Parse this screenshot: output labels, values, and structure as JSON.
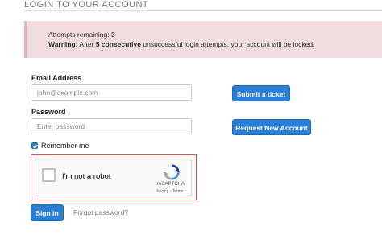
{
  "header": {
    "title": "LOGIN TO YOUR ACCOUNT"
  },
  "alert": {
    "attempts_label": "Attempts remaining:",
    "attempts_value": "3",
    "warning_label": "Warning:",
    "warning_pre": "After",
    "warning_bold": "5 consecutive",
    "warning_post": "unsuccessful login attempts, your account will be locked."
  },
  "form": {
    "email_label": "Email Address",
    "email_placeholder": "john@example.com",
    "password_label": "Password",
    "password_placeholder": "Enter password",
    "remember_label": "Remember me",
    "remember_checked": true,
    "sign_in_label": "Sign in",
    "forgot_label": "Forgot password?"
  },
  "side_buttons": {
    "submit_ticket": "Submit a ticket",
    "request_account": "Request New Account"
  },
  "recaptcha": {
    "label": "I'm not a robot",
    "brand": "reCAPTCHA",
    "terms": "Privacy - Terms"
  },
  "colors": {
    "primary": "#2a7fd4",
    "alert_bg": "#f2dede",
    "captcha_error_border": "#d9534f"
  }
}
